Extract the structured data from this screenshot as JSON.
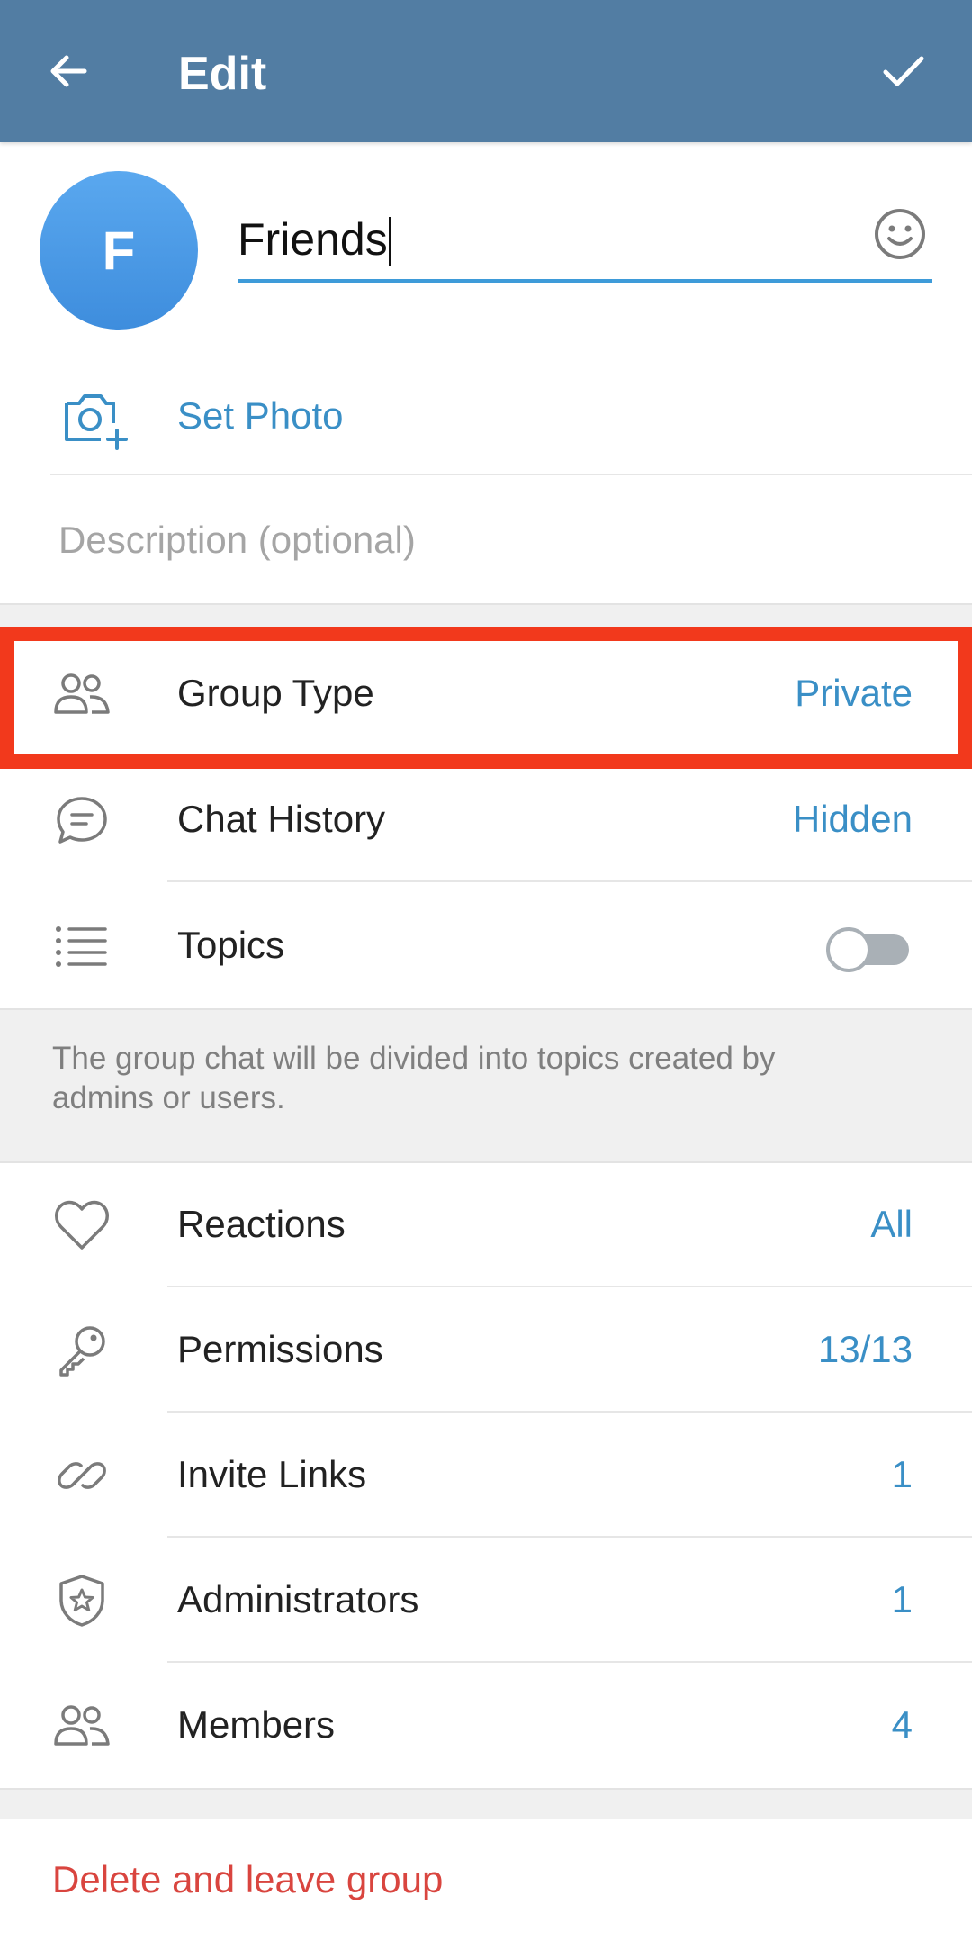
{
  "appbar": {
    "title": "Edit"
  },
  "group": {
    "avatar_letter": "F",
    "name": "Friends"
  },
  "set_photo": {
    "label": "Set Photo"
  },
  "description": {
    "placeholder": "Description (optional)"
  },
  "settings": {
    "group_type": {
      "label": "Group Type",
      "value": "Private"
    },
    "chat_history": {
      "label": "Chat History",
      "value": "Hidden"
    },
    "topics": {
      "label": "Topics",
      "enabled": false
    }
  },
  "topics_info": "The group chat will be divided into topics created by admins or users.",
  "manage": {
    "reactions": {
      "label": "Reactions",
      "value": "All"
    },
    "permissions": {
      "label": "Permissions",
      "value": "13/13"
    },
    "invite_links": {
      "label": "Invite Links",
      "value": "1"
    },
    "administrators": {
      "label": "Administrators",
      "value": "1"
    },
    "members": {
      "label": "Members",
      "value": "4"
    }
  },
  "delete_label": "Delete and leave group",
  "colors": {
    "appbar": "#527da3",
    "accent": "#3a8fc6",
    "highlight": "#f2391c",
    "danger": "#d9453f"
  },
  "icons": {
    "back": "arrow-left-icon",
    "done": "checkmark-icon",
    "emoji": "smiley-icon",
    "set_photo": "camera-add-icon",
    "group_type": "people-icon",
    "chat_history": "chat-bubble-icon",
    "topics": "list-icon",
    "reactions": "heart-icon",
    "permissions": "key-icon",
    "invite_links": "link-icon",
    "administrators": "shield-star-icon",
    "members": "people-icon"
  }
}
